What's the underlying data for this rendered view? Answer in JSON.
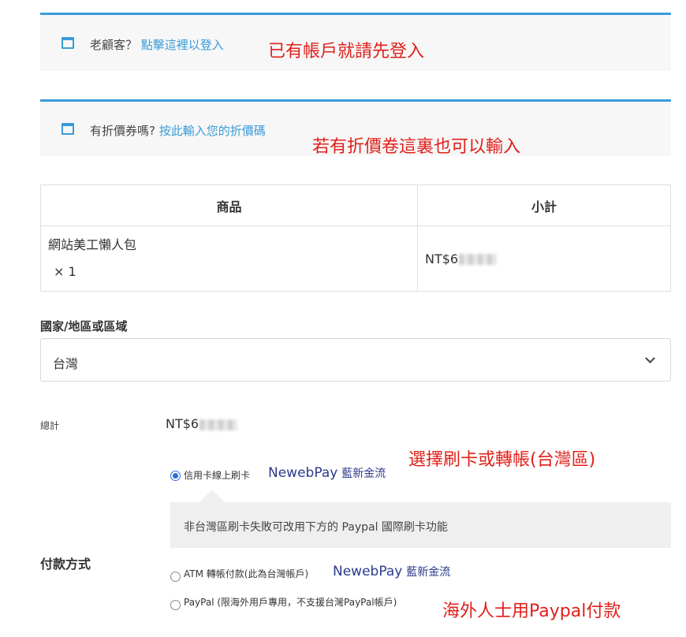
{
  "notices": {
    "returning": {
      "prefix": "老顧客？",
      "link": "點擊這裡以登入"
    },
    "coupon": {
      "prefix": "有折價券嗎?",
      "link": "按此輸入您的折價碼"
    }
  },
  "annotations": {
    "login": "已有帳戶就請先登入",
    "coupon": "若有折價卷這裏也可以輸入",
    "card": "選擇刷卡或轉帳(台灣區)",
    "paypal": "海外人士用Paypal付款"
  },
  "cart": {
    "headers": {
      "product": "商品",
      "subtotal": "小計"
    },
    "item": {
      "name": "網站美工懶人包",
      "qty": "× 1",
      "price_prefix": "NT$6"
    }
  },
  "country": {
    "label": "國家/地區或區域",
    "value": "台灣"
  },
  "total": {
    "label": "總計",
    "prefix": "NT$6"
  },
  "payment": {
    "section_label": "付款方式",
    "options": [
      {
        "label": "信用卡線上刷卡",
        "logo": "NewebPay",
        "logo_zh": "藍新金流",
        "selected": true
      },
      {
        "label": "ATM 轉帳付款(此為台灣帳戶)",
        "logo": "NewebPay",
        "logo_zh": "藍新金流",
        "selected": false
      },
      {
        "label": "PayPal (限海外用戶專用，不支援台灣PayPal帳戶)",
        "selected": false
      }
    ],
    "card_note": "非台灣區刷卡失敗可改用下方的 Paypal 國際刷卡功能"
  },
  "colors": {
    "accent": "#3a9bd8",
    "annotation": "#e0201b",
    "newebpay": "#2b3a8c"
  }
}
